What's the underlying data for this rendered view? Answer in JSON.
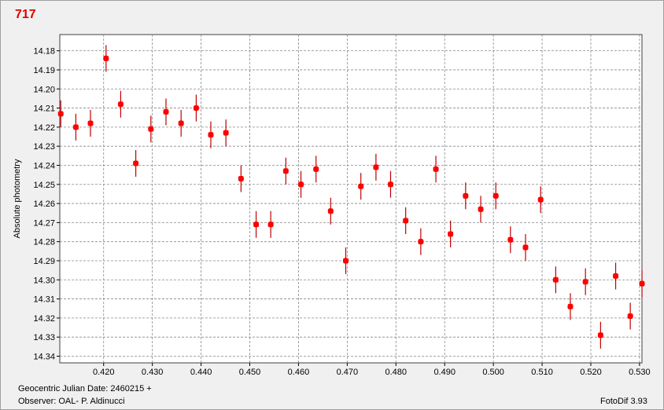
{
  "title": "717",
  "footer": {
    "date_label": "Geocentric Julian Date: 2460215 +",
    "observer": "Observer: OAL- P. Aldinucci",
    "software": "FotoDif 3.93"
  },
  "colors": {
    "marker": "#ff0000",
    "errorbar": "#c00000",
    "title": "#e00000",
    "grid": "#888888"
  },
  "chart_data": {
    "type": "scatter",
    "ylabel": "Absolute photometry",
    "xlabel": "",
    "x_ticks": [
      "0.420",
      "0.430",
      "0.440",
      "0.450",
      "0.460",
      "0.470",
      "0.480",
      "0.490",
      "0.500",
      "0.510",
      "0.520",
      "0.530"
    ],
    "y_ticks": [
      "14.18",
      "14.19",
      "14.20",
      "14.21",
      "14.22",
      "14.23",
      "14.24",
      "14.25",
      "14.26",
      "14.27",
      "14.28",
      "14.29",
      "14.30",
      "14.31",
      "14.32",
      "14.33",
      "14.34"
    ],
    "xlim": [
      0.411,
      0.5305
    ],
    "ylim": [
      14.1715,
      14.3435
    ],
    "y_inverted": true,
    "grid": true,
    "points": [
      {
        "x": 0.4112,
        "y": 14.213,
        "err": 0.007
      },
      {
        "x": 0.4143,
        "y": 14.22,
        "err": 0.007
      },
      {
        "x": 0.4173,
        "y": 14.218,
        "err": 0.007
      },
      {
        "x": 0.4205,
        "y": 14.184,
        "err": 0.007
      },
      {
        "x": 0.4235,
        "y": 14.208,
        "err": 0.007
      },
      {
        "x": 0.4266,
        "y": 14.239,
        "err": 0.007
      },
      {
        "x": 0.4297,
        "y": 14.221,
        "err": 0.007
      },
      {
        "x": 0.4328,
        "y": 14.212,
        "err": 0.007
      },
      {
        "x": 0.4359,
        "y": 14.218,
        "err": 0.007
      },
      {
        "x": 0.439,
        "y": 14.21,
        "err": 0.007
      },
      {
        "x": 0.442,
        "y": 14.224,
        "err": 0.007
      },
      {
        "x": 0.4451,
        "y": 14.223,
        "err": 0.007
      },
      {
        "x": 0.4482,
        "y": 14.247,
        "err": 0.007
      },
      {
        "x": 0.4513,
        "y": 14.271,
        "err": 0.007
      },
      {
        "x": 0.4543,
        "y": 14.271,
        "err": 0.007
      },
      {
        "x": 0.4574,
        "y": 14.243,
        "err": 0.007
      },
      {
        "x": 0.4605,
        "y": 14.25,
        "err": 0.007
      },
      {
        "x": 0.4636,
        "y": 14.242,
        "err": 0.007
      },
      {
        "x": 0.4666,
        "y": 14.264,
        "err": 0.007
      },
      {
        "x": 0.4697,
        "y": 14.29,
        "err": 0.007
      },
      {
        "x": 0.4728,
        "y": 14.251,
        "err": 0.007
      },
      {
        "x": 0.4759,
        "y": 14.241,
        "err": 0.007
      },
      {
        "x": 0.4789,
        "y": 14.25,
        "err": 0.007
      },
      {
        "x": 0.482,
        "y": 14.269,
        "err": 0.007
      },
      {
        "x": 0.4851,
        "y": 14.28,
        "err": 0.007
      },
      {
        "x": 0.4882,
        "y": 14.242,
        "err": 0.007
      },
      {
        "x": 0.4912,
        "y": 14.276,
        "err": 0.007
      },
      {
        "x": 0.4943,
        "y": 14.256,
        "err": 0.007
      },
      {
        "x": 0.4974,
        "y": 14.263,
        "err": 0.007
      },
      {
        "x": 0.5005,
        "y": 14.256,
        "err": 0.007
      },
      {
        "x": 0.5035,
        "y": 14.279,
        "err": 0.007
      },
      {
        "x": 0.5066,
        "y": 14.283,
        "err": 0.007
      },
      {
        "x": 0.5097,
        "y": 14.258,
        "err": 0.007
      },
      {
        "x": 0.5128,
        "y": 14.3,
        "err": 0.007
      },
      {
        "x": 0.5158,
        "y": 14.314,
        "err": 0.007
      },
      {
        "x": 0.5189,
        "y": 14.301,
        "err": 0.007
      },
      {
        "x": 0.522,
        "y": 14.329,
        "err": 0.007
      },
      {
        "x": 0.5251,
        "y": 14.298,
        "err": 0.007
      },
      {
        "x": 0.5281,
        "y": 14.319,
        "err": 0.007
      },
      {
        "x": 0.5305,
        "y": 14.302,
        "err": 0.007
      }
    ]
  }
}
